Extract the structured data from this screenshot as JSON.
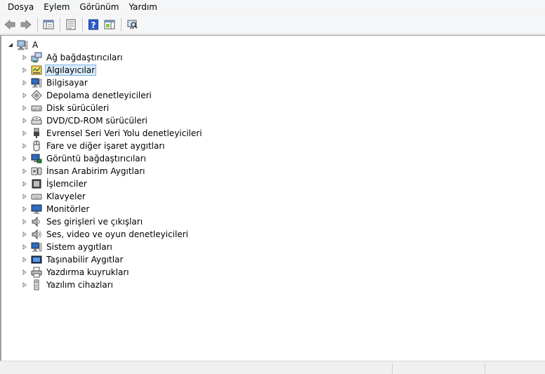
{
  "menu": [
    "Dosya",
    "Eylem",
    "Görünüm",
    "Yardım"
  ],
  "toolbar": {
    "buttons": [
      "back-arrow-icon",
      "forward-arrow-icon",
      "show-hide-console-tree-icon",
      "properties-icon",
      "help-icon",
      "action-pane-icon",
      "scan-hardware-icon"
    ]
  },
  "tree": {
    "root": "A",
    "selected_index": 1,
    "items": [
      {
        "label": "Ağ bağdaştırıcıları",
        "icon": "network-adapter-icon"
      },
      {
        "label": "Algılayıcılar",
        "icon": "sensor-icon"
      },
      {
        "label": "Bilgisayar",
        "icon": "computer-icon"
      },
      {
        "label": "Depolama denetleyicileri",
        "icon": "storage-controller-icon"
      },
      {
        "label": "Disk sürücüleri",
        "icon": "disk-drive-icon"
      },
      {
        "label": "DVD/CD-ROM sürücüleri",
        "icon": "dvd-drive-icon"
      },
      {
        "label": "Evrensel Seri Veri Yolu denetleyicileri",
        "icon": "usb-icon"
      },
      {
        "label": "Fare ve diğer işaret aygıtları",
        "icon": "mouse-icon"
      },
      {
        "label": "Görüntü bağdaştırıcıları",
        "icon": "display-adapter-icon"
      },
      {
        "label": "İnsan Arabirim Aygıtları",
        "icon": "hid-icon"
      },
      {
        "label": "İşlemciler",
        "icon": "processor-icon"
      },
      {
        "label": "Klavyeler",
        "icon": "keyboard-icon"
      },
      {
        "label": "Monitörler",
        "icon": "monitor-icon"
      },
      {
        "label": "Ses girişleri ve çıkışları",
        "icon": "speaker-icon"
      },
      {
        "label": "Ses, video ve oyun denetleyicileri",
        "icon": "sound-controller-icon"
      },
      {
        "label": "Sistem aygıtları",
        "icon": "system-devices-icon"
      },
      {
        "label": "Taşınabilir Aygıtlar",
        "icon": "portable-device-icon"
      },
      {
        "label": "Yazdırma kuyrukları",
        "icon": "printer-icon"
      },
      {
        "label": "Yazılım cihazları",
        "icon": "software-device-icon"
      }
    ]
  },
  "colors": {
    "selection_bg": "#d9ebf9",
    "selection_border": "#7eb4ea",
    "help_blue": "#2a5bd0"
  }
}
